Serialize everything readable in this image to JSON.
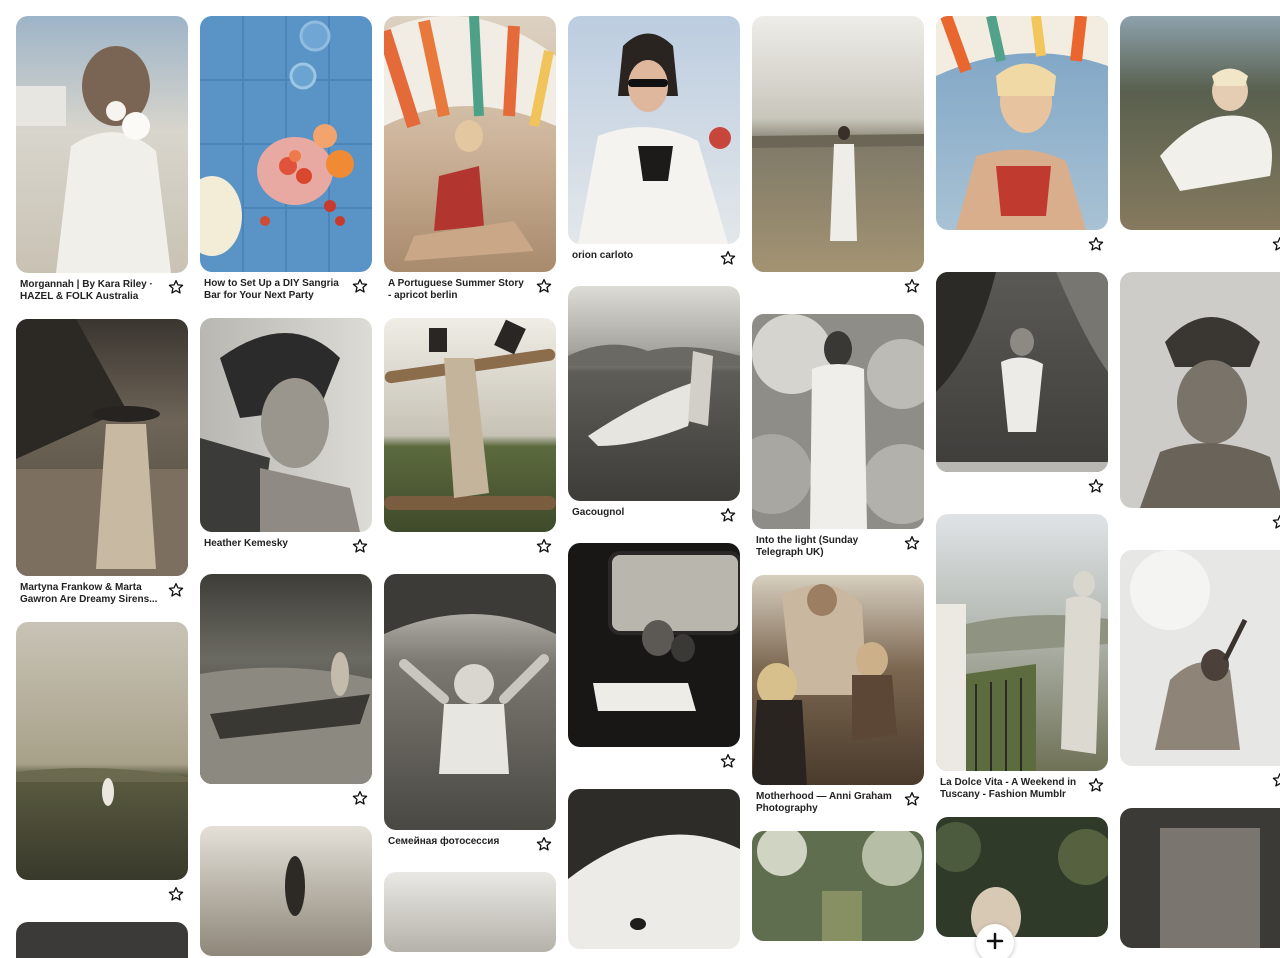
{
  "columns": [
    {
      "pins": [
        {
          "title": "Morgannah | By Kara Riley · HAZEL & FOLK Australia",
          "icon": "star-outline-icon"
        },
        {
          "title": "Martyna Frankow & Marta Gawron Are Dreamy Sirens...",
          "icon": "star-outline-icon"
        },
        {
          "title": "",
          "icon": "star-outline-icon"
        }
      ]
    },
    {
      "pins": [
        {
          "title": "How to Set Up a DIY Sangria Bar for Your Next Party",
          "icon": "star-outline-icon"
        },
        {
          "title": "Heather Kemesky",
          "icon": "star-outline-icon"
        },
        {
          "title": "",
          "icon": "star-outline-icon"
        }
      ]
    },
    {
      "pins": [
        {
          "title": "A Portuguese Summer Story - apricot berlin",
          "icon": "star-outline-icon"
        },
        {
          "title": "",
          "icon": "star-outline-icon"
        },
        {
          "title": "Семейная фотосессия",
          "icon": "star-outline-icon"
        }
      ]
    },
    {
      "pins": [
        {
          "title": "orion carloto",
          "icon": "star-outline-icon"
        },
        {
          "title": "Gacougnol",
          "icon": "star-outline-icon"
        },
        {
          "title": "",
          "icon": "star-outline-icon"
        }
      ]
    },
    {
      "pins": [
        {
          "title": "",
          "icon": "star-outline-icon"
        },
        {
          "title": "Into the light (Sunday Telegraph UK)",
          "icon": "star-outline-icon"
        },
        {
          "title": "Motherhood — Anni Graham Photography",
          "icon": "star-outline-icon"
        }
      ]
    },
    {
      "pins": [
        {
          "title": "",
          "icon": "star-outline-icon"
        },
        {
          "title": "",
          "icon": "star-outline-icon"
        },
        {
          "title": "La Dolce Vita - A Weekend in Tuscany - Fashion Mumblr",
          "icon": "star-outline-icon"
        }
      ]
    },
    {
      "pins": [
        {
          "title": "",
          "icon": "star-outline-icon"
        },
        {
          "title": "",
          "icon": "star-outline-icon"
        },
        {
          "title": "",
          "icon": "star-outline-icon"
        }
      ]
    }
  ],
  "add_button": {
    "icon": "plus-icon"
  }
}
